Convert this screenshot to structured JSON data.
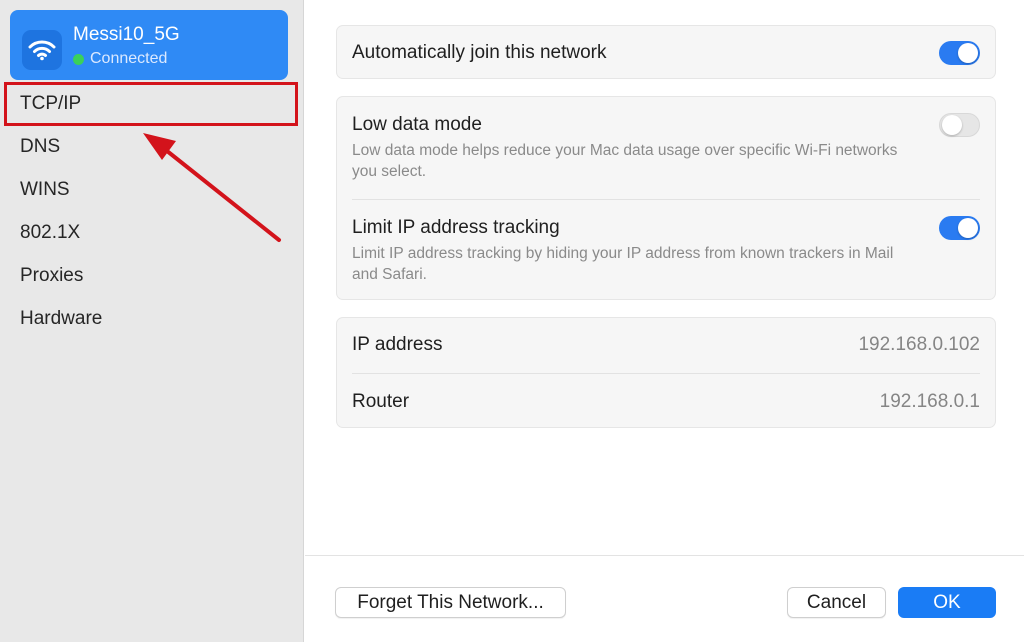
{
  "network": {
    "name": "Messi10_5G",
    "status": "Connected",
    "icon": "wifi-icon"
  },
  "sidebar": {
    "items": [
      {
        "label": "TCP/IP",
        "highlighted": true
      },
      {
        "label": "DNS"
      },
      {
        "label": "WINS"
      },
      {
        "label": "802.1X"
      },
      {
        "label": "Proxies"
      },
      {
        "label": "Hardware"
      }
    ]
  },
  "settings": {
    "auto_join": {
      "label": "Automatically join this network",
      "enabled": true
    },
    "low_data": {
      "label": "Low data mode",
      "description": "Low data mode helps reduce your Mac data usage over specific Wi-Fi networks you select.",
      "enabled": false
    },
    "limit_ip": {
      "label": "Limit IP address tracking",
      "description": "Limit IP address tracking by hiding your IP address from known trackers in Mail and Safari.",
      "enabled": true
    }
  },
  "info": {
    "ip_label": "IP address",
    "ip_value": "192.168.0.102",
    "router_label": "Router",
    "router_value": "192.168.0.1"
  },
  "footer": {
    "forget_label": "Forget This Network...",
    "cancel_label": "Cancel",
    "ok_label": "OK"
  },
  "colors": {
    "accent": "#2a7bf1",
    "highlight": "#d3131b",
    "status_green": "#3ad15a"
  }
}
